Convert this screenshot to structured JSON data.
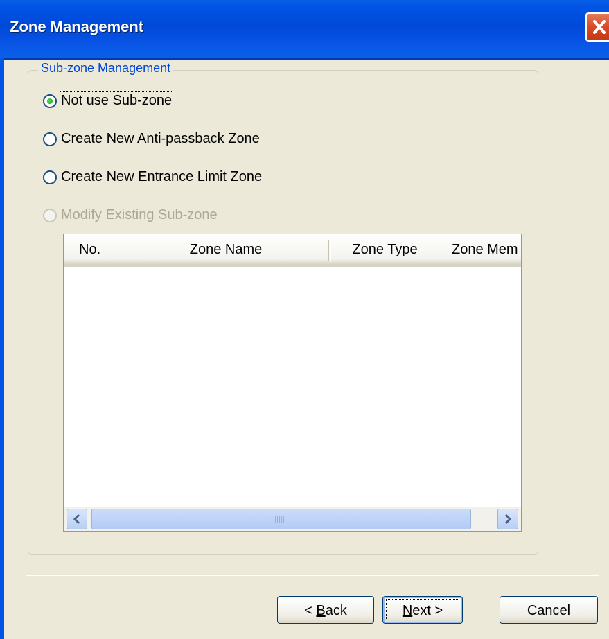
{
  "window": {
    "title": "Zone Management",
    "close_icon": "close-icon"
  },
  "group": {
    "legend": "Sub-zone Management"
  },
  "options": [
    {
      "label": "Not use Sub-zone",
      "selected": true,
      "enabled": true
    },
    {
      "label": "Create New Anti-passback Zone",
      "selected": false,
      "enabled": true
    },
    {
      "label": "Create New Entrance Limit Zone",
      "selected": false,
      "enabled": true
    },
    {
      "label": "Modify Existing Sub-zone",
      "selected": false,
      "enabled": false
    }
  ],
  "list": {
    "columns": [
      "No.",
      "Zone Name",
      "Zone Type",
      "Zone Mem"
    ],
    "rows": []
  },
  "buttons": {
    "back": {
      "prefix": "< ",
      "mnemonic": "B",
      "rest": "ack"
    },
    "next": {
      "mnemonic": "N",
      "rest": "ext >"
    },
    "cancel": "Cancel"
  },
  "colors": {
    "title_bar": "#0054e3",
    "dialog_bg": "#ece9d8",
    "group_legend": "#0046d5",
    "disabled_text": "#aca899",
    "close_button": "#d94a26"
  }
}
